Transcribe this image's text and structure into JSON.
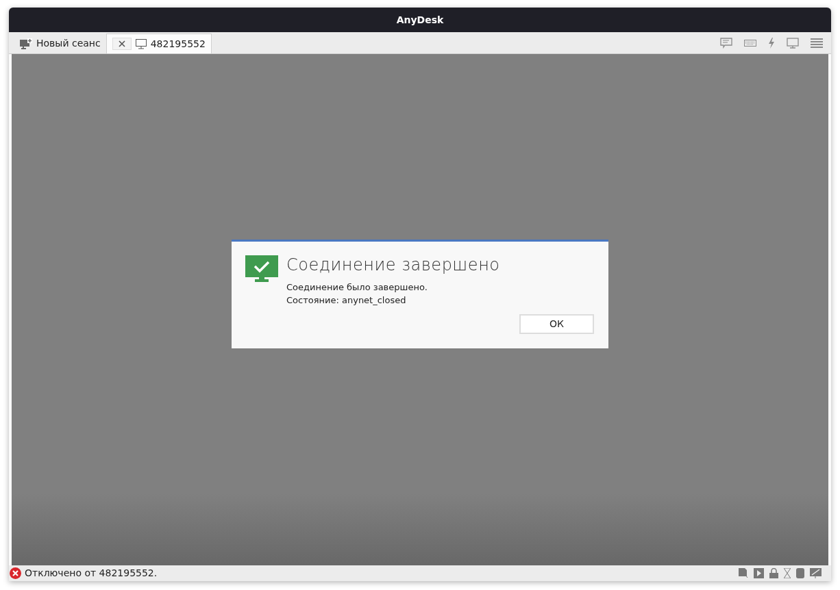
{
  "window": {
    "title": "AnyDesk"
  },
  "tabs": [
    {
      "kind": "new",
      "label": "Новый сеанс",
      "selected": false
    },
    {
      "kind": "session",
      "label": "482195552",
      "selected": true
    }
  ],
  "dialog": {
    "title": "Соединение завершено",
    "lines": [
      "Соединение было завершено.",
      "Состояние: anynet_closed"
    ],
    "button": "ОК"
  },
  "status_bar": {
    "text": "Отключено от 482195552."
  }
}
